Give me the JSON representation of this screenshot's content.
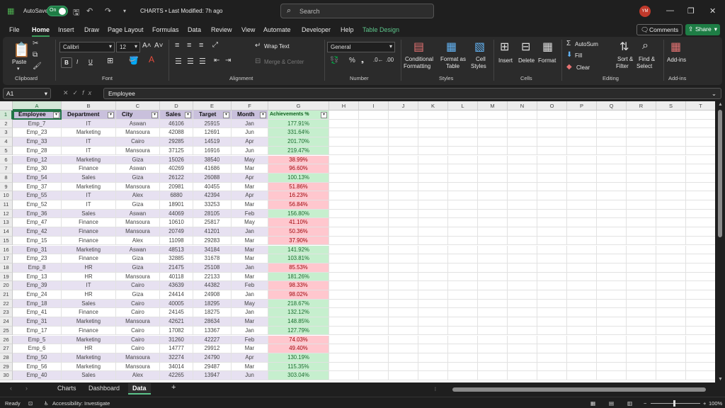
{
  "titlebar": {
    "autosave_label": "AutoSave",
    "autosave_state": "On",
    "doc_title": "CHARTS • Last Modified: 7h ago",
    "search_placeholder": "Search",
    "user_initials": "YM"
  },
  "menu": {
    "tabs": [
      "File",
      "Home",
      "Insert",
      "Draw",
      "Page Layout",
      "Formulas",
      "Data",
      "Review",
      "View",
      "Automate",
      "Developer",
      "Help",
      "Table Design"
    ],
    "active_tab": "Home",
    "comments_label": "Comments",
    "share_label": "Share"
  },
  "ribbon": {
    "clipboard": {
      "label": "Clipboard",
      "paste": "Paste"
    },
    "font": {
      "label": "Font",
      "name": "Calibri",
      "size": "12",
      "bold": "B",
      "italic": "I",
      "underline": "U"
    },
    "alignment": {
      "label": "Alignment",
      "wrap_text": "Wrap Text",
      "merge_center": "Merge & Center"
    },
    "number": {
      "label": "Number",
      "format": "General"
    },
    "styles": {
      "label": "Styles",
      "conditional": "Conditional",
      "conditional2": "Formatting",
      "format_as": "Format as",
      "format_as2": "Table",
      "cell_styles": "Cell",
      "cell_styles2": "Styles"
    },
    "cells": {
      "label": "Cells",
      "insert": "Insert",
      "delete": "Delete",
      "format": "Format"
    },
    "editing": {
      "label": "Editing",
      "autosum": "AutoSum",
      "fill": "Fill",
      "clear": "Clear",
      "sort": "Sort &",
      "sort2": "Filter",
      "find": "Find &",
      "find2": "Select"
    },
    "addins": {
      "label": "Add-ins",
      "addins": "Add-ins"
    }
  },
  "formula_bar": {
    "name_box": "A1",
    "fx": "fx",
    "content": "Employee"
  },
  "grid": {
    "columns": [
      "A",
      "B",
      "C",
      "D",
      "E",
      "F",
      "G",
      "H",
      "I",
      "J",
      "K",
      "L",
      "M",
      "N",
      "O",
      "P",
      "Q",
      "R",
      "S",
      "T"
    ],
    "headers": [
      "Employee",
      "Department",
      "City",
      "Sales",
      "Target",
      "Month",
      "Achievements %"
    ],
    "rows": [
      [
        "Emp_7",
        "IT",
        "Aswan",
        "46106",
        "25915",
        "Jan",
        "177.91%"
      ],
      [
        "Emp_23",
        "Marketing",
        "Mansoura",
        "42088",
        "12691",
        "Jun",
        "331.64%"
      ],
      [
        "Emp_33",
        "IT",
        "Cairo",
        "29285",
        "14519",
        "Apr",
        "201.70%"
      ],
      [
        "Emp_28",
        "IT",
        "Mansoura",
        "37125",
        "16916",
        "Jun",
        "219.47%"
      ],
      [
        "Emp_12",
        "Marketing",
        "Giza",
        "15026",
        "38540",
        "May",
        "38.99%"
      ],
      [
        "Emp_30",
        "Finance",
        "Aswan",
        "40269",
        "41686",
        "Mar",
        "96.60%"
      ],
      [
        "Emp_54",
        "Sales",
        "Giza",
        "26122",
        "26088",
        "Apr",
        "100.13%"
      ],
      [
        "Emp_37",
        "Marketing",
        "Mansoura",
        "20981",
        "40455",
        "Mar",
        "51.86%"
      ],
      [
        "Emp_55",
        "IT",
        "Alex",
        "6880",
        "42394",
        "Apr",
        "16.23%"
      ],
      [
        "Emp_52",
        "IT",
        "Giza",
        "18901",
        "33253",
        "Mar",
        "56.84%"
      ],
      [
        "Emp_36",
        "Sales",
        "Aswan",
        "44069",
        "28105",
        "Feb",
        "156.80%"
      ],
      [
        "Emp_47",
        "Finance",
        "Mansoura",
        "10610",
        "25817",
        "May",
        "41.10%"
      ],
      [
        "Emp_42",
        "Finance",
        "Mansoura",
        "20749",
        "41201",
        "Jan",
        "50.36%"
      ],
      [
        "Emp_15",
        "Finance",
        "Alex",
        "11098",
        "29283",
        "Mar",
        "37.90%"
      ],
      [
        "Emp_31",
        "Marketing",
        "Aswan",
        "48513",
        "34184",
        "Mar",
        "141.92%"
      ],
      [
        "Emp_23",
        "Finance",
        "Giza",
        "32885",
        "31678",
        "Mar",
        "103.81%"
      ],
      [
        "Emp_8",
        "HR",
        "Giza",
        "21475",
        "25108",
        "Jan",
        "85.53%"
      ],
      [
        "Emp_13",
        "HR",
        "Mansoura",
        "40118",
        "22133",
        "Mar",
        "181.26%"
      ],
      [
        "Emp_39",
        "IT",
        "Cairo",
        "43639",
        "44382",
        "Feb",
        "98.33%"
      ],
      [
        "Emp_24",
        "HR",
        "Giza",
        "24414",
        "24908",
        "Jan",
        "98.02%"
      ],
      [
        "Emp_18",
        "Sales",
        "Cairo",
        "40005",
        "18295",
        "May",
        "218.67%"
      ],
      [
        "Emp_41",
        "Finance",
        "Cairo",
        "24145",
        "18275",
        "Jan",
        "132.12%"
      ],
      [
        "Emp_31",
        "Marketing",
        "Mansoura",
        "42621",
        "28634",
        "Mar",
        "148.85%"
      ],
      [
        "Emp_17",
        "Finance",
        "Cairo",
        "17082",
        "13367",
        "Jan",
        "127.79%"
      ],
      [
        "Emp_5",
        "Marketing",
        "Cairo",
        "31260",
        "42227",
        "Feb",
        "74.03%"
      ],
      [
        "Emp_6",
        "HR",
        "Cairo",
        "14777",
        "29912",
        "Mar",
        "49.40%"
      ],
      [
        "Emp_50",
        "Marketing",
        "Mansoura",
        "32274",
        "24790",
        "Apr",
        "130.19%"
      ],
      [
        "Emp_56",
        "Marketing",
        "Mansoura",
        "34014",
        "29487",
        "Mar",
        "115.35%"
      ],
      [
        "Emp_40",
        "Sales",
        "Alex",
        "42265",
        "13947",
        "Jun",
        "303.04%"
      ]
    ]
  },
  "sheets": {
    "tabs": [
      "Charts",
      "Dashboard",
      "Data"
    ],
    "active": "Data",
    "add": "+"
  },
  "status": {
    "ready": "Ready",
    "accessibility": "Accessibility: Investigate",
    "zoom": "100%"
  },
  "colors": {
    "accent": "#217346",
    "good_fill": "#c6efce",
    "bad_fill": "#ffc7ce",
    "header_fill": "#c9c0dc",
    "band_fill": "#e7e1f1"
  }
}
